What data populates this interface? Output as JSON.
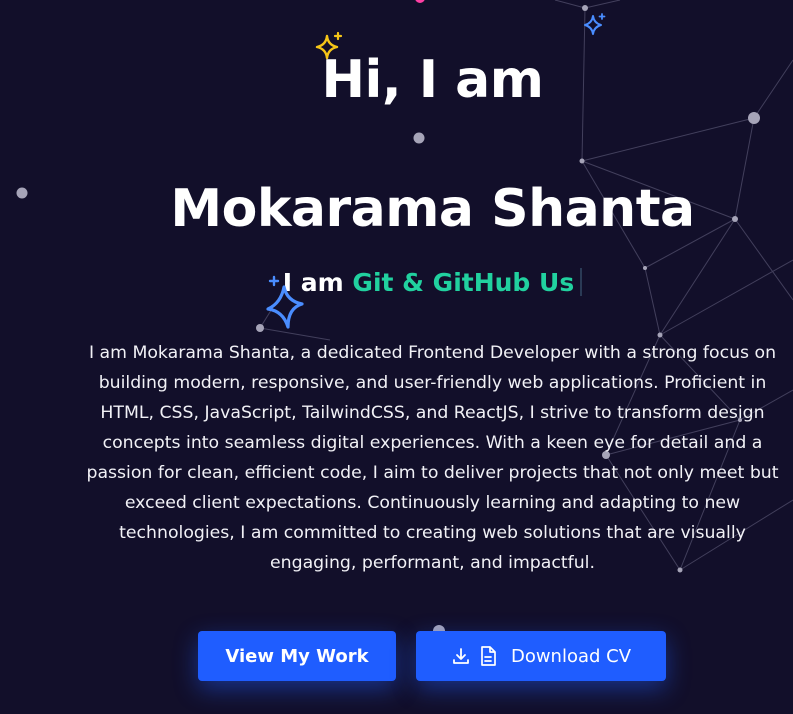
{
  "hero": {
    "greeting": "Hi, I am",
    "name": "Mokarama Shanta",
    "typing_prefix": "I am",
    "typing_word": "Git & GitHub Us",
    "bio": "I am Mokarama Shanta, a dedicated Frontend Developer with a strong focus on building modern, responsive, and user-friendly web applications. Proficient in HTML, CSS, JavaScript, TailwindCSS, and ReactJS, I strive to transform design concepts into seamless digital experiences. With a keen eye for detail and a passion for clean, efficient code, I aim to deliver projects that not only meet but exceed client expectations. Continuously learning and adapting to new technologies, I am committed to creating web solutions that are visually engaging, performant, and impactful."
  },
  "buttons": {
    "view_work_label": "View My Work",
    "download_cv_label": "Download CV"
  },
  "icons": {
    "download": "download-icon",
    "file": "file-icon",
    "sparkle_colors": [
      "#f5c518",
      "#4a8dff",
      "#4a8dff"
    ]
  },
  "colors": {
    "background": "#120f2a",
    "accent_text": "#21d19f",
    "button": "#1f5dff"
  }
}
